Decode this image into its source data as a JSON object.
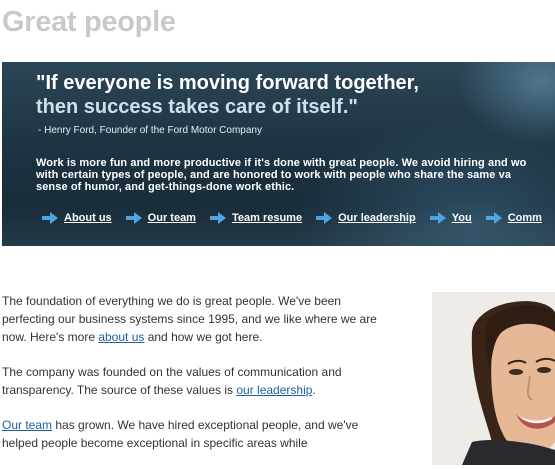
{
  "page": {
    "title": "Great people"
  },
  "banner": {
    "quote_line1": "\"If everyone is moving forward together,",
    "quote_line2": "then success takes care of itself.\"",
    "attribution": "- Henry Ford, Founder of the Ford Motor Company",
    "intro_line1": "Work is more fun and more productive if it's done with great people. We avoid hiring and wo",
    "intro_line2": "with certain types of people, and are honored to work with people who share the same va",
    "intro_line3": "sense of humor, and get-things-done work ethic."
  },
  "nav": {
    "items": [
      {
        "label": "About us",
        "icon": "arrow-right-icon"
      },
      {
        "label": "Our team",
        "icon": "arrow-right-icon"
      },
      {
        "label": "Team resume",
        "icon": "arrow-right-icon"
      },
      {
        "label": "Our leadership",
        "icon": "arrow-right-icon"
      },
      {
        "label": "You",
        "icon": "arrow-right-icon"
      },
      {
        "label": "Comm",
        "icon": "arrow-right-icon"
      }
    ]
  },
  "content": {
    "p1_a": "The foundation of everything we do is great people.  We've been perfecting our business systems since 1995, and we like where we are now.  Here's more ",
    "p1_link": "about us",
    "p1_b": " and how we got here.",
    "p2_a": "The company was founded on the values of communication and transparency.  The source of these values is ",
    "p2_link": "our leadership",
    "p2_b": ".",
    "p3_link": "Our team",
    "p3_a": " has grown.  We have hired exceptional people, and we've helped people become exceptional in specific areas while"
  },
  "colors": {
    "banner_dark": "#1e3443",
    "nav_arrow": "#4aa3e0",
    "link": "#1f5fa0",
    "title_gray": "#c9c9c9"
  }
}
